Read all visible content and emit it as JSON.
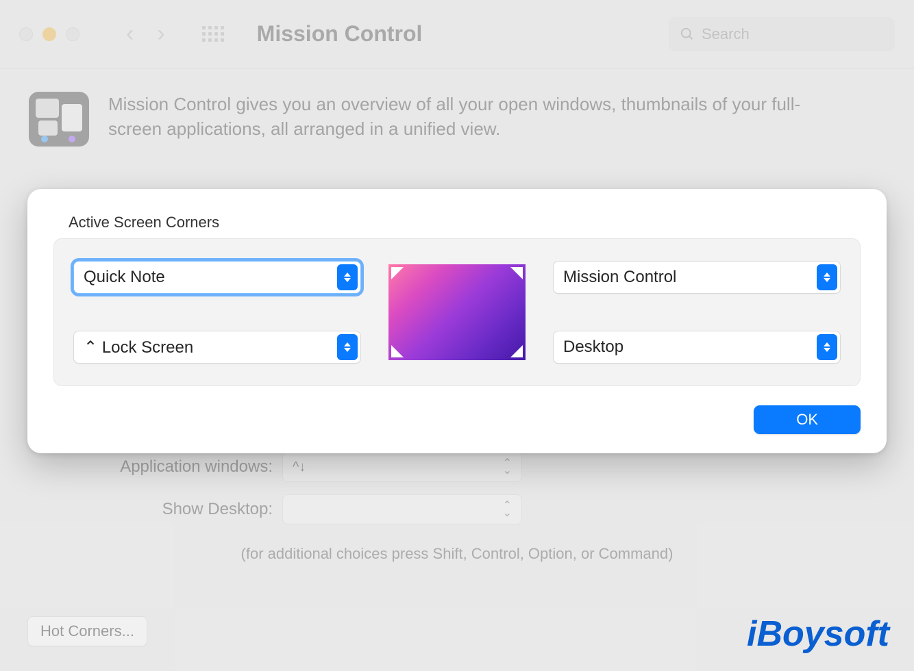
{
  "window": {
    "title": "Mission Control",
    "search_placeholder": "Search"
  },
  "header": {
    "description": "Mission Control gives you an overview of all your open windows, thumbnails of your full-screen applications, all arranged in a unified view."
  },
  "background_form": {
    "rows": [
      {
        "label": "Application windows:",
        "value": "^↓"
      },
      {
        "label": "Show Desktop:",
        "value": ""
      }
    ],
    "hint": "(for additional choices press Shift, Control, Option, or Command)",
    "hot_corners_button": "Hot Corners..."
  },
  "modal": {
    "title": "Active Screen Corners",
    "corners": {
      "top_left": "Quick Note",
      "top_right": "Mission Control",
      "bottom_left": "⌃ Lock Screen",
      "bottom_right": "Desktop"
    },
    "ok_label": "OK"
  },
  "watermark": "iBoysoft"
}
